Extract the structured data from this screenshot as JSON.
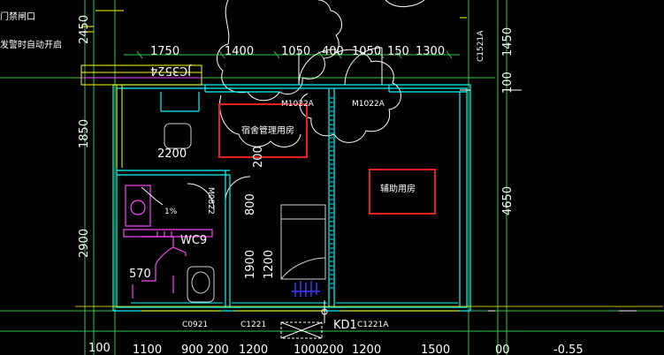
{
  "notes": {
    "line1": "门禁闸口",
    "line2": "发警时自动开启"
  },
  "rooms": {
    "dorm_admin": "宿舍管理用房",
    "aux": "辅助用房",
    "wc": "WC9",
    "slope": "1%"
  },
  "doors": {
    "m1022a_left": "M1022A",
    "m1022a_right": "M1022A",
    "m0822": "M0822",
    "jc3524": "JC3524",
    "c1521a": "C1521A",
    "kd1": "KD1"
  },
  "windows": {
    "c0921": "C0921",
    "c1221": "C1221",
    "c1221a": "C1221A"
  },
  "dims_top": [
    "1750",
    "1400",
    "1050",
    "400",
    "1050",
    "150",
    "1300"
  ],
  "dims_left": [
    "2450",
    "1850",
    "2900"
  ],
  "dims_right": [
    "1450",
    "100",
    "4650"
  ],
  "dims_inner": [
    "2200",
    "200",
    "800",
    "1900",
    "1200",
    "570"
  ],
  "dims_bottom": [
    "100",
    "1100",
    "900",
    "200",
    "1200",
    "1000",
    "200",
    "1200",
    "1500",
    "00"
  ],
  "level": "-0.55",
  "colors": {
    "wall": "#00ffff",
    "pink": "#ff44ff",
    "yellow": "#ffff00",
    "red": "#e8201c",
    "green": "#2ecc40",
    "blue": "#3a3aff"
  }
}
